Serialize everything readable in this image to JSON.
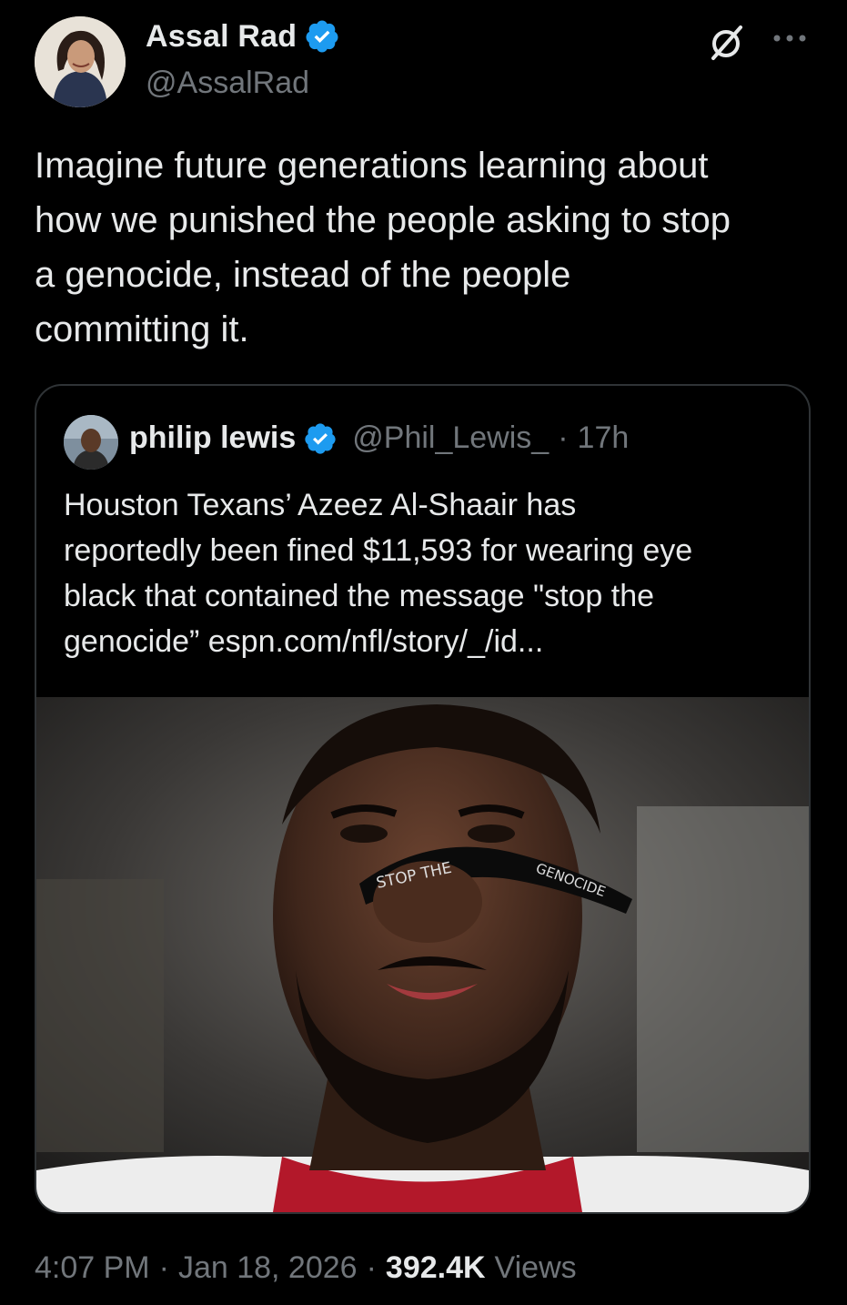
{
  "author": {
    "name": "Assal Rad",
    "handle": "@AssalRad",
    "verified_color": "#1d9bf0"
  },
  "tweet": {
    "text": "Imagine future generations learning about\nhow we punished the people asking to stop\na genocide, instead of the people\ncommitting it."
  },
  "quote": {
    "name": "philip lewis",
    "handle": "@Phil_Lewis_",
    "separator": "·",
    "age": "17h",
    "text": "Houston Texans’ Azeez Al-Shaair has\nreportedly been fined $11,593 for wearing eye\nblack that contained the message \"stop the\ngenocide” espn.com/nfl/story/_/id...",
    "image_text_left": "STOP THE",
    "image_text_right": "GENOCIDE"
  },
  "meta": {
    "time": "4:07 PM",
    "sep1": "·",
    "date": "Jan 18, 2026",
    "sep2": "·",
    "views_count": "392.4K",
    "views_label": "Views"
  },
  "icons": {
    "grok": "grok-icon",
    "more": "more-icon",
    "verified": "verified-badge-icon"
  }
}
